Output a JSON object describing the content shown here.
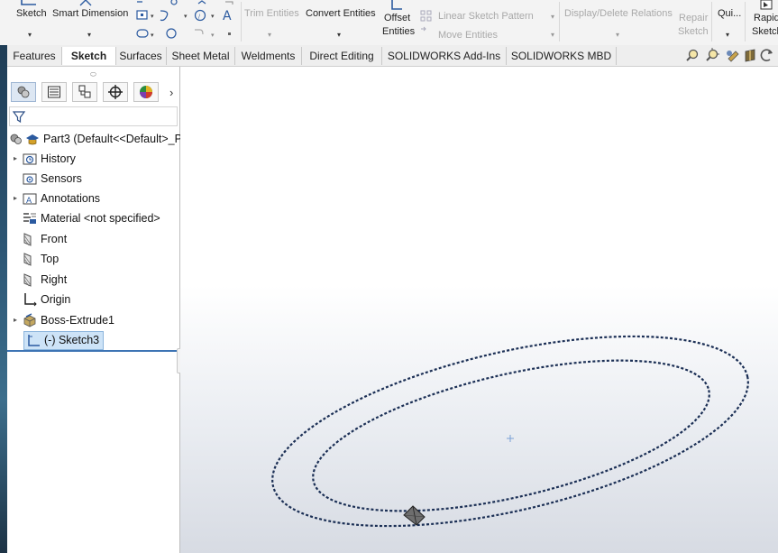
{
  "ribbon": {
    "sketch": "Sketch",
    "smart_dimension": "Smart Dimension",
    "trim_entities": "Trim Entities",
    "convert_entities": "Convert Entities",
    "offset_line1": "Offset",
    "offset_line2": "Entities",
    "linear_sketch_pattern": "Linear Sketch Pattern",
    "move_entities": "Move Entities",
    "display_delete_relations": "Display/Delete Relations",
    "repair_line1": "Repair",
    "repair_line2": "Sketch",
    "quick_snaps": "Qui...",
    "rapid_line1": "Rapid",
    "rapid_line2": "Sketch"
  },
  "tabs": [
    {
      "label": "Features"
    },
    {
      "label": "Sketch"
    },
    {
      "label": "Surfaces"
    },
    {
      "label": "Sheet Metal"
    },
    {
      "label": "Weldments"
    },
    {
      "label": "Direct Editing"
    },
    {
      "label": "SOLIDWORKS Add-Ins"
    },
    {
      "label": "SOLIDWORKS MBD"
    }
  ],
  "active_tab": "Sketch",
  "tree": {
    "root": "Part3  (Default<<Default>_P",
    "items": [
      {
        "label": "History",
        "expandable": true
      },
      {
        "label": "Sensors",
        "expandable": false
      },
      {
        "label": "Annotations",
        "expandable": true
      },
      {
        "label": "Material <not specified>",
        "expandable": false
      },
      {
        "label": "Front",
        "expandable": false
      },
      {
        "label": "Top",
        "expandable": false
      },
      {
        "label": "Right",
        "expandable": false
      },
      {
        "label": "Origin",
        "expandable": false
      },
      {
        "label": "Boss-Extrude1",
        "expandable": true
      },
      {
        "label": "(-) Sketch3",
        "expandable": false,
        "selected": true
      }
    ]
  },
  "colors": {
    "accent": "#3d74b4",
    "selection": "#cde3f7",
    "sketch_curve": "#1b2f55"
  }
}
